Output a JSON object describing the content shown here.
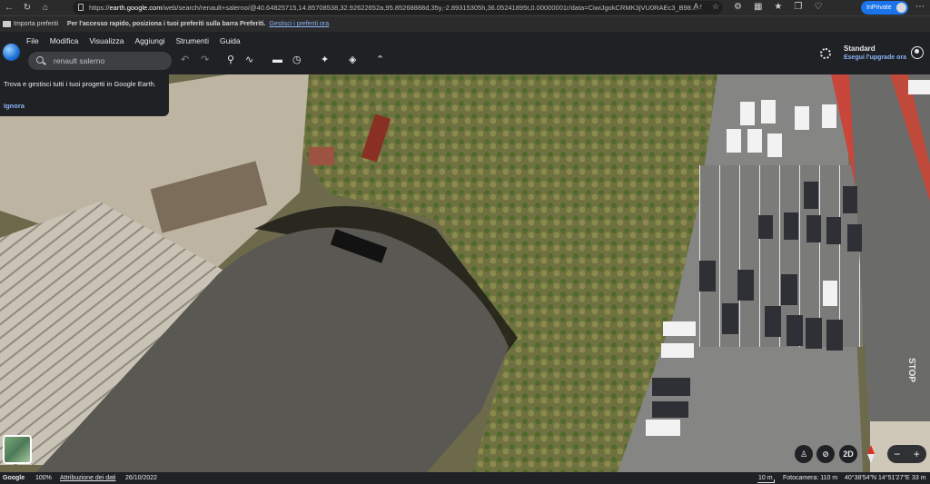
{
  "browser": {
    "url_scheme": "https://",
    "url_host": "earth.google.com",
    "url_rest": "/web/search/renault+salerno/@40.64825715,14.85708538,32.92622652a,95.85268888d,35y,-2.89315305h,36.05241895t,0.00000001r/data=CiwiJgokCRMK3jVU0RAEc3_B98...",
    "inprivate_label": "InPrivate",
    "favorites_import_label": "Importa preferiti",
    "favorites_hint": "Per l'accesso rapido, posiziona i tuoi preferiti sulla barra Preferiti.",
    "favorites_manage_link": "Gestisci i preferiti ora",
    "icons": [
      "back-icon",
      "refresh-icon",
      "home-icon",
      "reader-icon",
      "favorite-star-icon",
      "extensions-icon",
      "collections-icon",
      "browser-essentials-icon",
      "more-icon"
    ]
  },
  "earth": {
    "menu": [
      "File",
      "Modifica",
      "Visualizza",
      "Aggiungi",
      "Strumenti",
      "Guida"
    ],
    "search_value": "renault salerno",
    "plan_label": "Standard",
    "upgrade_label": "Esegui l'upgrade ora",
    "tip_text": "Trova e gestisci tutti i tuoi progetti in Google Earth.",
    "tip_dismiss": "Ignora",
    "view_mode": "2D",
    "tools": [
      "undo-icon",
      "redo-icon",
      "placemark-icon",
      "path-icon",
      "ruler-icon",
      "history-icon",
      "voyager-icon",
      "layers-icon",
      "collapse-icon"
    ],
    "road_marking_text": "STOP"
  },
  "status": {
    "brand": "Google",
    "zoom": "100%",
    "attribution_label": "Attribuzione dei dati",
    "date": "26/10/2022",
    "scale": "10 m",
    "camera": "Fotocamera: 110 m",
    "coords": "40°38'54\"N 14°51'27\"E",
    "elevation": "33 m"
  },
  "colors": {
    "app_bg": "#202124",
    "accent_blue": "#8ab4f8",
    "inprivate_blue": "#1a73e8",
    "chrome_bg": "#2b2b2b"
  }
}
